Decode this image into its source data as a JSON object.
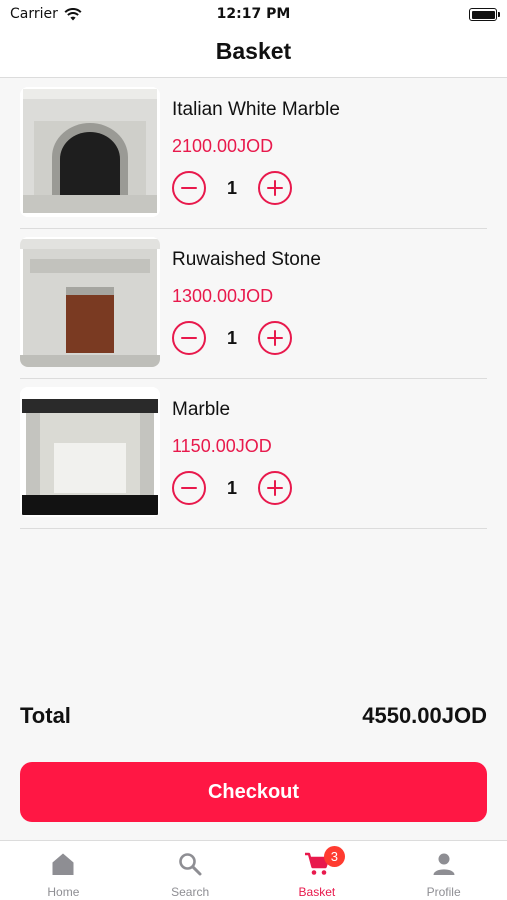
{
  "status_bar": {
    "carrier": "Carrier",
    "time": "12:17 PM"
  },
  "header": {
    "title": "Basket"
  },
  "basket": {
    "items": [
      {
        "name": "Italian White Marble",
        "price": "2100.00JOD",
        "quantity": "1"
      },
      {
        "name": "Ruwaished Stone",
        "price": "1300.00JOD",
        "quantity": "1"
      },
      {
        "name": "Marble",
        "price": "1150.00JOD",
        "quantity": "1"
      }
    ]
  },
  "summary": {
    "total_label": "Total",
    "total_value": "4550.00JOD"
  },
  "checkout": {
    "label": "Checkout"
  },
  "tabs": [
    {
      "label": "Home",
      "icon": "home-icon"
    },
    {
      "label": "Search",
      "icon": "search-icon"
    },
    {
      "label": "Basket",
      "icon": "cart-icon",
      "badge": "3",
      "active": true
    },
    {
      "label": "Profile",
      "icon": "person-icon"
    }
  ],
  "colors": {
    "accent": "#e8194c",
    "checkout": "#ff1744",
    "badge": "#ff3b30"
  }
}
